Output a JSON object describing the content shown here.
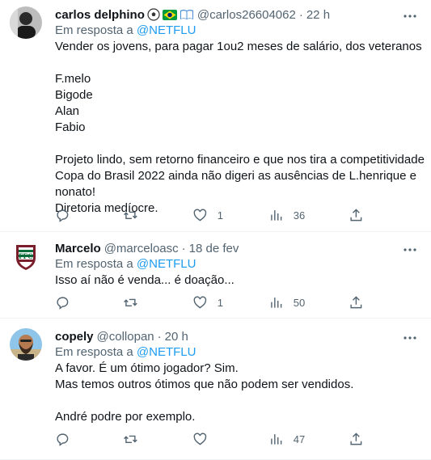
{
  "replying_label": "Em resposta a",
  "tweets": [
    {
      "name": "carlos delphino",
      "name_emojis": [
        "soccer-ball",
        "brazil-flag",
        "open-book"
      ],
      "handle": "@carlos26604062",
      "sep": "·",
      "time": "22 h",
      "reply_to": "@NETFLU",
      "lines": [
        "Vender os jovens, para pagar 1ou2 meses de  salário, dos veteranos",
        "",
        "F.melo",
        "Bigode",
        "Alan",
        "Fabio",
        "",
        "Projeto lindo, sem retorno financeiro e que nos tira a competitividade",
        "Copa do Brasil 2022 ainda não digeri as ausências de L.henrique e",
        "nonato!",
        "Diretoria medíocre."
      ],
      "reply_count": "",
      "retweet_count": "",
      "like_count": "1",
      "view_count": "36"
    },
    {
      "name": "Marcelo",
      "handle": "@marceloasc",
      "sep": "·",
      "time": "18 de fev",
      "reply_to": "@NETFLU",
      "lines": [
        "Isso aí não é venda... é doação..."
      ],
      "reply_count": "",
      "retweet_count": "",
      "like_count": "1",
      "view_count": "50"
    },
    {
      "name": "copely",
      "handle": "@collopan",
      "sep": "·",
      "time": "20 h",
      "reply_to": "@NETFLU",
      "lines": [
        "A favor. É um ótimo jogador? Sim.",
        "Mas temos outros ótimos que não podem ser vendidos.",
        "",
        "André podre por exemplo."
      ],
      "reply_count": "",
      "retweet_count": "",
      "like_count": "",
      "view_count": "47"
    }
  ],
  "colors": {
    "accent": "#1d9bf0",
    "secondary_text": "#536471",
    "text": "#0f1419",
    "divider": "#eff3f4"
  }
}
